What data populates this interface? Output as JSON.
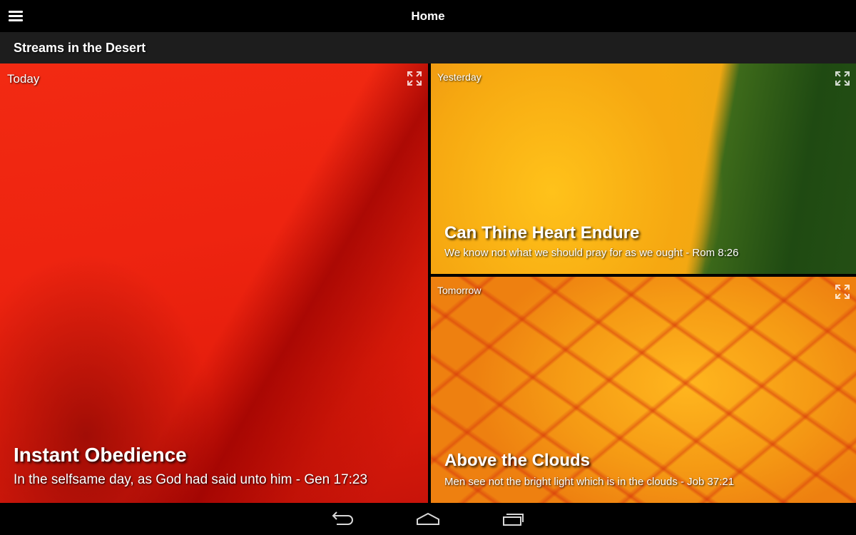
{
  "app_bar": {
    "title": "Home",
    "menu_icon": "hamburger-menu-icon"
  },
  "sub_bar": {
    "title": "Streams in the Desert"
  },
  "tiles": {
    "today": {
      "label": "Today",
      "title": "Instant Obedience",
      "subtitle": "In the selfsame day, as God had said unto him - Gen 17:23",
      "icon": "expand-icon",
      "accent": "#ee2410"
    },
    "yesterday": {
      "label": "Yesterday",
      "title": "Can Thine Heart Endure",
      "subtitle": "We know not what we should pray for as we ought - Rom 8:26",
      "icon": "expand-icon",
      "accent": "#f6a90f"
    },
    "tomorrow": {
      "label": "Tomorrow",
      "title": "Above the Clouds",
      "subtitle": "Men see not the bright light which is in the clouds - Job 37:21",
      "icon": "expand-icon",
      "accent": "#f59a14"
    }
  },
  "nav_bar": {
    "back_icon": "back-icon",
    "home_icon": "home-icon",
    "recent_icon": "recent-apps-icon"
  }
}
